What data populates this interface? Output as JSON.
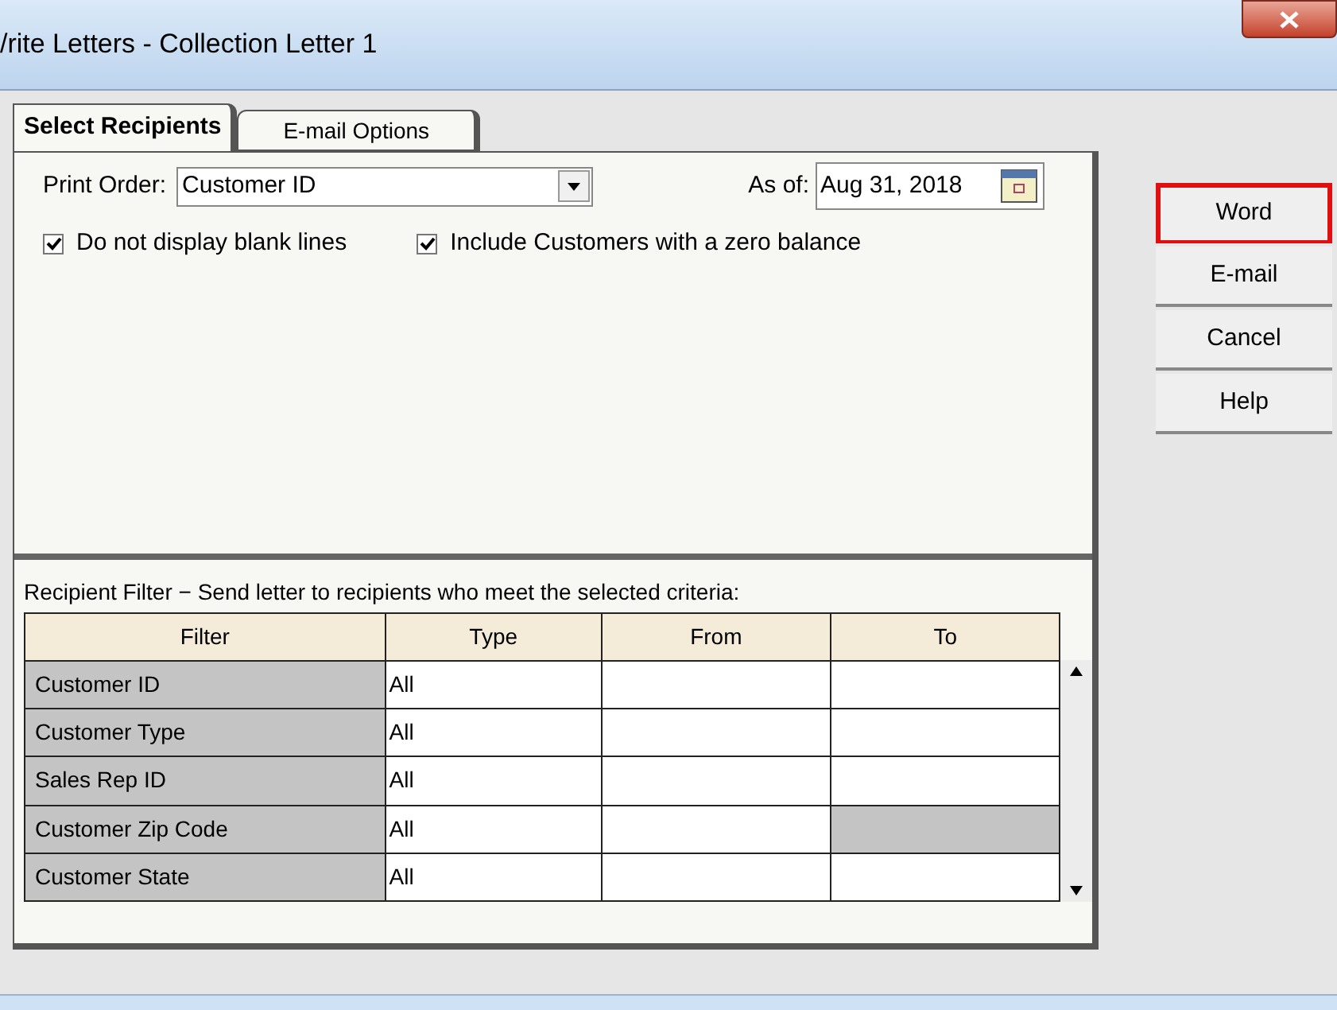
{
  "window": {
    "title": "/rite Letters - Collection Letter 1"
  },
  "tabs": [
    {
      "label": "Select Recipients",
      "selected": true
    },
    {
      "label": "E-mail Options",
      "selected": false
    }
  ],
  "print_order": {
    "label": "Print Order:",
    "value": "Customer ID"
  },
  "as_of": {
    "label": "As of:",
    "value": "Aug 31, 2018"
  },
  "checkboxes": [
    {
      "label": "Do not display blank lines",
      "checked": true
    },
    {
      "label": "Include Customers with a zero balance",
      "checked": true
    }
  ],
  "filter_caption": "Recipient Filter − Send letter to recipients who meet the selected criteria:",
  "table": {
    "columns": [
      "Filter",
      "Type",
      "From",
      "To"
    ],
    "rows": [
      {
        "filter": "Customer ID",
        "type": "All",
        "from": "",
        "to": "",
        "to_disabled": false
      },
      {
        "filter": "Customer Type",
        "type": "All",
        "from": "",
        "to": "",
        "to_disabled": false
      },
      {
        "filter": "Sales Rep ID",
        "type": "All",
        "from": "",
        "to": "",
        "to_disabled": false
      },
      {
        "filter": "Customer Zip Code",
        "type": "All",
        "from": "",
        "to": "",
        "to_disabled": true
      },
      {
        "filter": "Customer State",
        "type": "All",
        "from": "",
        "to": "",
        "to_disabled": false
      }
    ]
  },
  "buttons": [
    {
      "label": "Word",
      "highlighted": true
    },
    {
      "label": "E-mail",
      "highlighted": false
    },
    {
      "label": "Cancel",
      "highlighted": false
    },
    {
      "label": "Help",
      "highlighted": false
    }
  ]
}
